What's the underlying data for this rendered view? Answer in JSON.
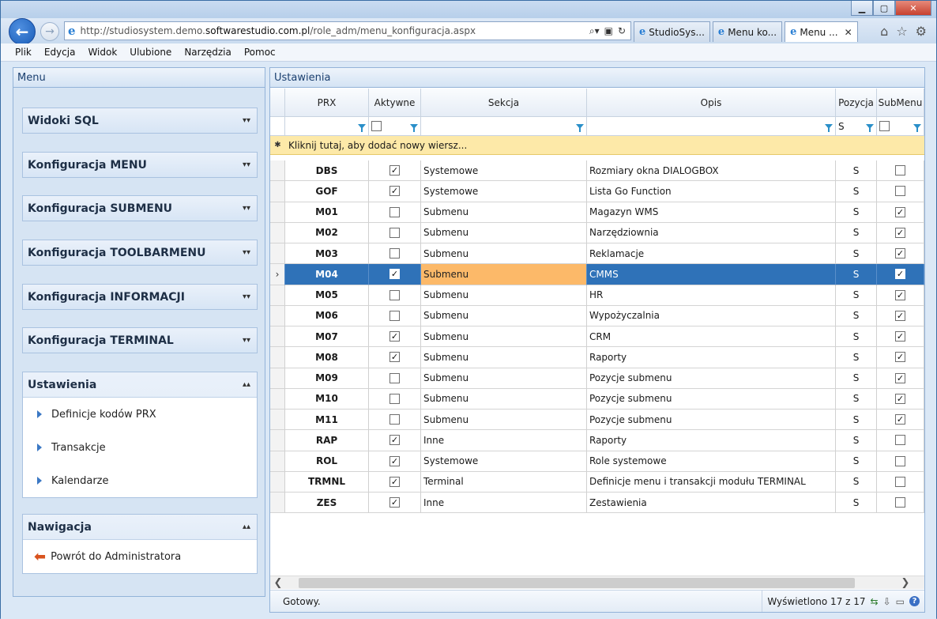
{
  "browser": {
    "url_prefix": "http://studiosystem.demo.",
    "url_domain": "softwarestudio.com.pl",
    "url_path": "/role_adm/menu_konfiguracja.aspx",
    "tabs": [
      {
        "label": "StudioSys..."
      },
      {
        "label": "Menu ko..."
      },
      {
        "label": "Menu ...",
        "active": true
      }
    ],
    "minimize": "▁",
    "maximize": "▢",
    "close": "✕",
    "tab_close": "✕"
  },
  "menubar": [
    "Plik",
    "Edycja",
    "Widok",
    "Ulubione",
    "Narzędzia",
    "Pomoc"
  ],
  "left": {
    "title": "Menu",
    "sections": [
      {
        "title": "Widoki SQL",
        "chev": "▾▾"
      },
      {
        "title": "Konfiguracja MENU",
        "chev": "▾▾"
      },
      {
        "title": "Konfiguracja SUBMENU",
        "chev": "▾▾"
      },
      {
        "title": "Konfiguracja TOOLBARMENU",
        "chev": "▾▾"
      },
      {
        "title": "Konfiguracja INFORMACJI",
        "chev": "▾▾"
      },
      {
        "title": "Konfiguracja TERMINAL",
        "chev": "▾▾"
      }
    ],
    "ustawienia": {
      "title": "Ustawienia",
      "chev": "▴▴",
      "items": [
        "Definicje kodów PRX",
        "Transakcje",
        "Kalendarze"
      ]
    },
    "nawigacja": {
      "title": "Nawigacja",
      "chev": "▴▴",
      "items": [
        "Powrót do Administratora"
      ]
    }
  },
  "right": {
    "title": "Ustawienia",
    "columns": {
      "prx": "PRX",
      "aktywne": "Aktywne",
      "sekcja": "Sekcja",
      "opis": "Opis",
      "pozycja": "Pozycja",
      "submenu": "SubMenu"
    },
    "filter": {
      "pozycja": "S"
    },
    "add_row": "Kliknij tutaj, aby dodać nowy wiersz...",
    "add_row_marker": "✱",
    "selected_marker": "›",
    "rows": [
      {
        "prx": "DBS",
        "aktywne": true,
        "sekcja": "Systemowe",
        "opis": "Rozmiary okna DIALOGBOX",
        "pozycja": "S",
        "submenu": false
      },
      {
        "prx": "GOF",
        "aktywne": true,
        "sekcja": "Systemowe",
        "opis": "Lista Go Function",
        "pozycja": "S",
        "submenu": false
      },
      {
        "prx": "M01",
        "aktywne": false,
        "sekcja": "Submenu",
        "opis": "Magazyn WMS",
        "pozycja": "S",
        "submenu": true
      },
      {
        "prx": "M02",
        "aktywne": false,
        "sekcja": "Submenu",
        "opis": "Narzędziownia",
        "pozycja": "S",
        "submenu": true
      },
      {
        "prx": "M03",
        "aktywne": false,
        "sekcja": "Submenu",
        "opis": "Reklamacje",
        "pozycja": "S",
        "submenu": true
      },
      {
        "prx": "M04",
        "aktywne": true,
        "sekcja": "Submenu",
        "opis": "CMMS",
        "pozycja": "S",
        "submenu": true,
        "selected": true
      },
      {
        "prx": "M05",
        "aktywne": false,
        "sekcja": "Submenu",
        "opis": "HR",
        "pozycja": "S",
        "submenu": true
      },
      {
        "prx": "M06",
        "aktywne": false,
        "sekcja": "Submenu",
        "opis": "Wypożyczalnia",
        "pozycja": "S",
        "submenu": true
      },
      {
        "prx": "M07",
        "aktywne": true,
        "sekcja": "Submenu",
        "opis": "CRM",
        "pozycja": "S",
        "submenu": true
      },
      {
        "prx": "M08",
        "aktywne": true,
        "sekcja": "Submenu",
        "opis": "Raporty",
        "pozycja": "S",
        "submenu": true
      },
      {
        "prx": "M09",
        "aktywne": false,
        "sekcja": "Submenu",
        "opis": "Pozycje submenu",
        "pozycja": "S",
        "submenu": true
      },
      {
        "prx": "M10",
        "aktywne": false,
        "sekcja": "Submenu",
        "opis": "Pozycje submenu",
        "pozycja": "S",
        "submenu": true
      },
      {
        "prx": "M11",
        "aktywne": false,
        "sekcja": "Submenu",
        "opis": "Pozycje submenu",
        "pozycja": "S",
        "submenu": true
      },
      {
        "prx": "RAP",
        "aktywne": true,
        "sekcja": "Inne",
        "opis": "Raporty",
        "pozycja": "S",
        "submenu": false
      },
      {
        "prx": "ROL",
        "aktywne": true,
        "sekcja": "Systemowe",
        "opis": "Role systemowe",
        "pozycja": "S",
        "submenu": false
      },
      {
        "prx": "TRMNL",
        "aktywne": true,
        "sekcja": "Terminal",
        "opis": "Definicje menu i transakcji modułu TERMINAL",
        "pozycja": "S",
        "submenu": false
      },
      {
        "prx": "ZES",
        "aktywne": true,
        "sekcja": "Inne",
        "opis": "Zestawienia",
        "pozycja": "S",
        "submenu": false
      }
    ],
    "status": "Gotowy.",
    "count": "Wyświetlono 17 z 17"
  }
}
